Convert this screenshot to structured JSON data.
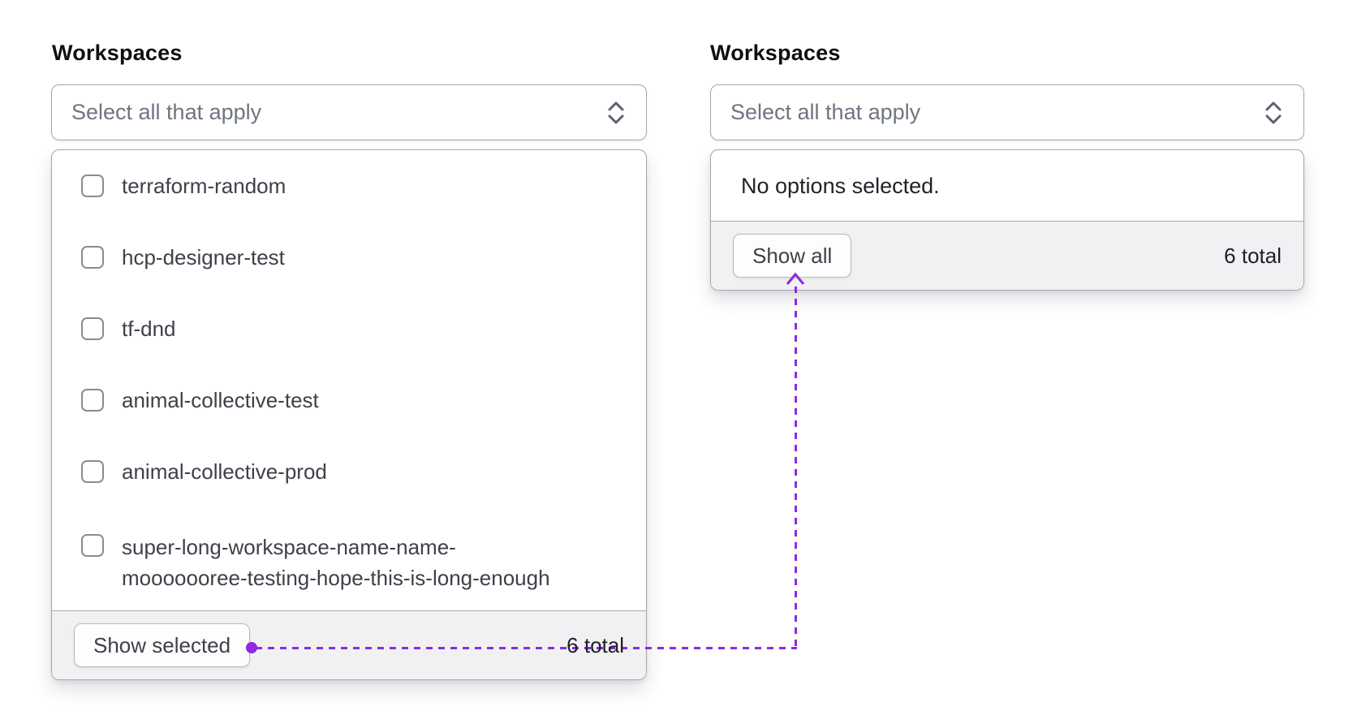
{
  "annotation": {
    "purple": "#8e2ae2"
  },
  "left_combobox": {
    "label": "Workspaces",
    "placeholder": "Select all that apply",
    "options": [
      "terraform-random",
      "hcp-designer-test",
      "tf-dnd",
      "animal-collective-test",
      "animal-collective-prod",
      "super-long-workspace-name-name-\nmooooooree-testing-hope-this-is-long-enough"
    ],
    "footer": {
      "button": "Show selected",
      "total": "6 total"
    }
  },
  "right_combobox": {
    "label": "Workspaces",
    "placeholder": "Select all that apply",
    "empty_message": "No options selected.",
    "footer": {
      "button": "Show all",
      "total": "6 total"
    }
  }
}
